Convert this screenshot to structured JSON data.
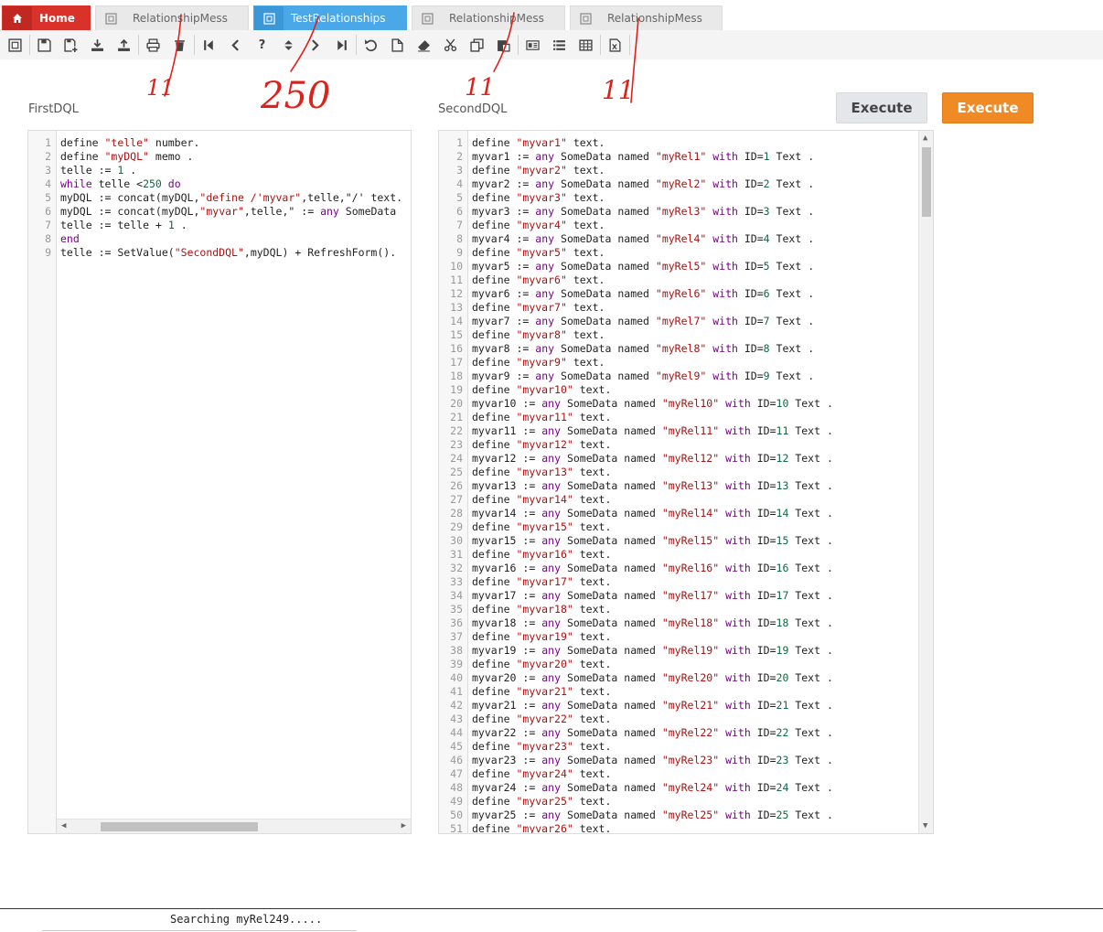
{
  "tabs": [
    {
      "label": "Home",
      "icon": "home-icon",
      "kind": "home"
    },
    {
      "label": "RelationshipMess",
      "icon": "form-icon",
      "kind": "normal"
    },
    {
      "label": "TestRelationships",
      "icon": "form-icon",
      "kind": "active"
    },
    {
      "label": "RelationshipMess",
      "icon": "form-icon",
      "kind": "normal"
    },
    {
      "label": "RelationshipMess",
      "icon": "form-icon",
      "kind": "normal"
    }
  ],
  "toolbar": {
    "icons": [
      "form-icon",
      "save-icon",
      "save-new-icon",
      "download-icon",
      "upload-icon",
      "print-icon",
      "delete-icon",
      "first-record-icon",
      "previous-record-icon",
      "help-icon",
      "sort-icon",
      "next-record-icon",
      "last-record-icon",
      "undo-icon",
      "new-document-icon",
      "eraser-icon",
      "cut-icon",
      "copy-icon",
      "paste-icon",
      "id-card-icon",
      "list-icon",
      "table-icon",
      "excel-icon"
    ]
  },
  "first_dql": {
    "label": "FirstDQL",
    "lines": [
      "define \"telle\" number.",
      "define \"myDQL\" memo .",
      "telle := 1 .",
      "while telle <250 do",
      "myDQL := concat(myDQL,\"define /'myvar\",telle,\"/' text.",
      "myDQL := concat(myDQL,\"myvar\",telle,\" := any SomeData",
      "telle := telle + 1 .",
      "end",
      "telle := SetValue(\"SecondDQL\",myDQL) + RefreshForm()."
    ]
  },
  "second_dql": {
    "label": "SecondDQL",
    "line_count": 51,
    "lines": [
      "define \"myvar1\" text.",
      "myvar1 := any SomeData named \"myRel1\" with ID=1 Text .",
      "define \"myvar2\" text.",
      "myvar2 := any SomeData named \"myRel2\" with ID=2 Text .",
      "define \"myvar3\" text.",
      "myvar3 := any SomeData named \"myRel3\" with ID=3 Text .",
      "define \"myvar4\" text.",
      "myvar4 := any SomeData named \"myRel4\" with ID=4 Text .",
      "define \"myvar5\" text.",
      "myvar5 := any SomeData named \"myRel5\" with ID=5 Text .",
      "define \"myvar6\" text.",
      "myvar6 := any SomeData named \"myRel6\" with ID=6 Text .",
      "define \"myvar7\" text.",
      "myvar7 := any SomeData named \"myRel7\" with ID=7 Text .",
      "define \"myvar8\" text.",
      "myvar8 := any SomeData named \"myRel8\" with ID=8 Text .",
      "define \"myvar9\" text.",
      "myvar9 := any SomeData named \"myRel9\" with ID=9 Text .",
      "define \"myvar10\" text.",
      "myvar10 := any SomeData named \"myRel10\" with ID=10 Text .",
      "define \"myvar11\" text.",
      "myvar11 := any SomeData named \"myRel11\" with ID=11 Text .",
      "define \"myvar12\" text.",
      "myvar12 := any SomeData named \"myRel12\" with ID=12 Text .",
      "define \"myvar13\" text.",
      "myvar13 := any SomeData named \"myRel13\" with ID=13 Text .",
      "define \"myvar14\" text.",
      "myvar14 := any SomeData named \"myRel14\" with ID=14 Text .",
      "define \"myvar15\" text.",
      "myvar15 := any SomeData named \"myRel15\" with ID=15 Text .",
      "define \"myvar16\" text.",
      "myvar16 := any SomeData named \"myRel16\" with ID=16 Text .",
      "define \"myvar17\" text.",
      "myvar17 := any SomeData named \"myRel17\" with ID=17 Text .",
      "define \"myvar18\" text.",
      "myvar18 := any SomeData named \"myRel18\" with ID=18 Text .",
      "define \"myvar19\" text.",
      "myvar19 := any SomeData named \"myRel19\" with ID=19 Text .",
      "define \"myvar20\" text.",
      "myvar20 := any SomeData named \"myRel20\" with ID=20 Text .",
      "define \"myvar21\" text.",
      "myvar21 := any SomeData named \"myRel21\" with ID=21 Text .",
      "define \"myvar22\" text.",
      "myvar22 := any SomeData named \"myRel22\" with ID=22 Text .",
      "define \"myvar23\" text.",
      "myvar23 := any SomeData named \"myRel23\" with ID=23 Text .",
      "define \"myvar24\" text.",
      "myvar24 := any SomeData named \"myRel24\" with ID=24 Text .",
      "define \"myvar25\" text.",
      "myvar25 := any SomeData named \"myRel25\" with ID=25 Text .",
      "define \"myvar26\" text."
    ]
  },
  "buttons": {
    "execute_secondary": "Execute",
    "execute_primary": "Execute"
  },
  "annotations": [
    "11",
    "250",
    "11",
    "11"
  ],
  "status": {
    "text": "Searching myRel249....."
  },
  "colors": {
    "home_tab": "#d9322b",
    "active_tab": "#4aa8e8",
    "execute_primary": "#f08a24",
    "annotation": "#e0201a"
  }
}
